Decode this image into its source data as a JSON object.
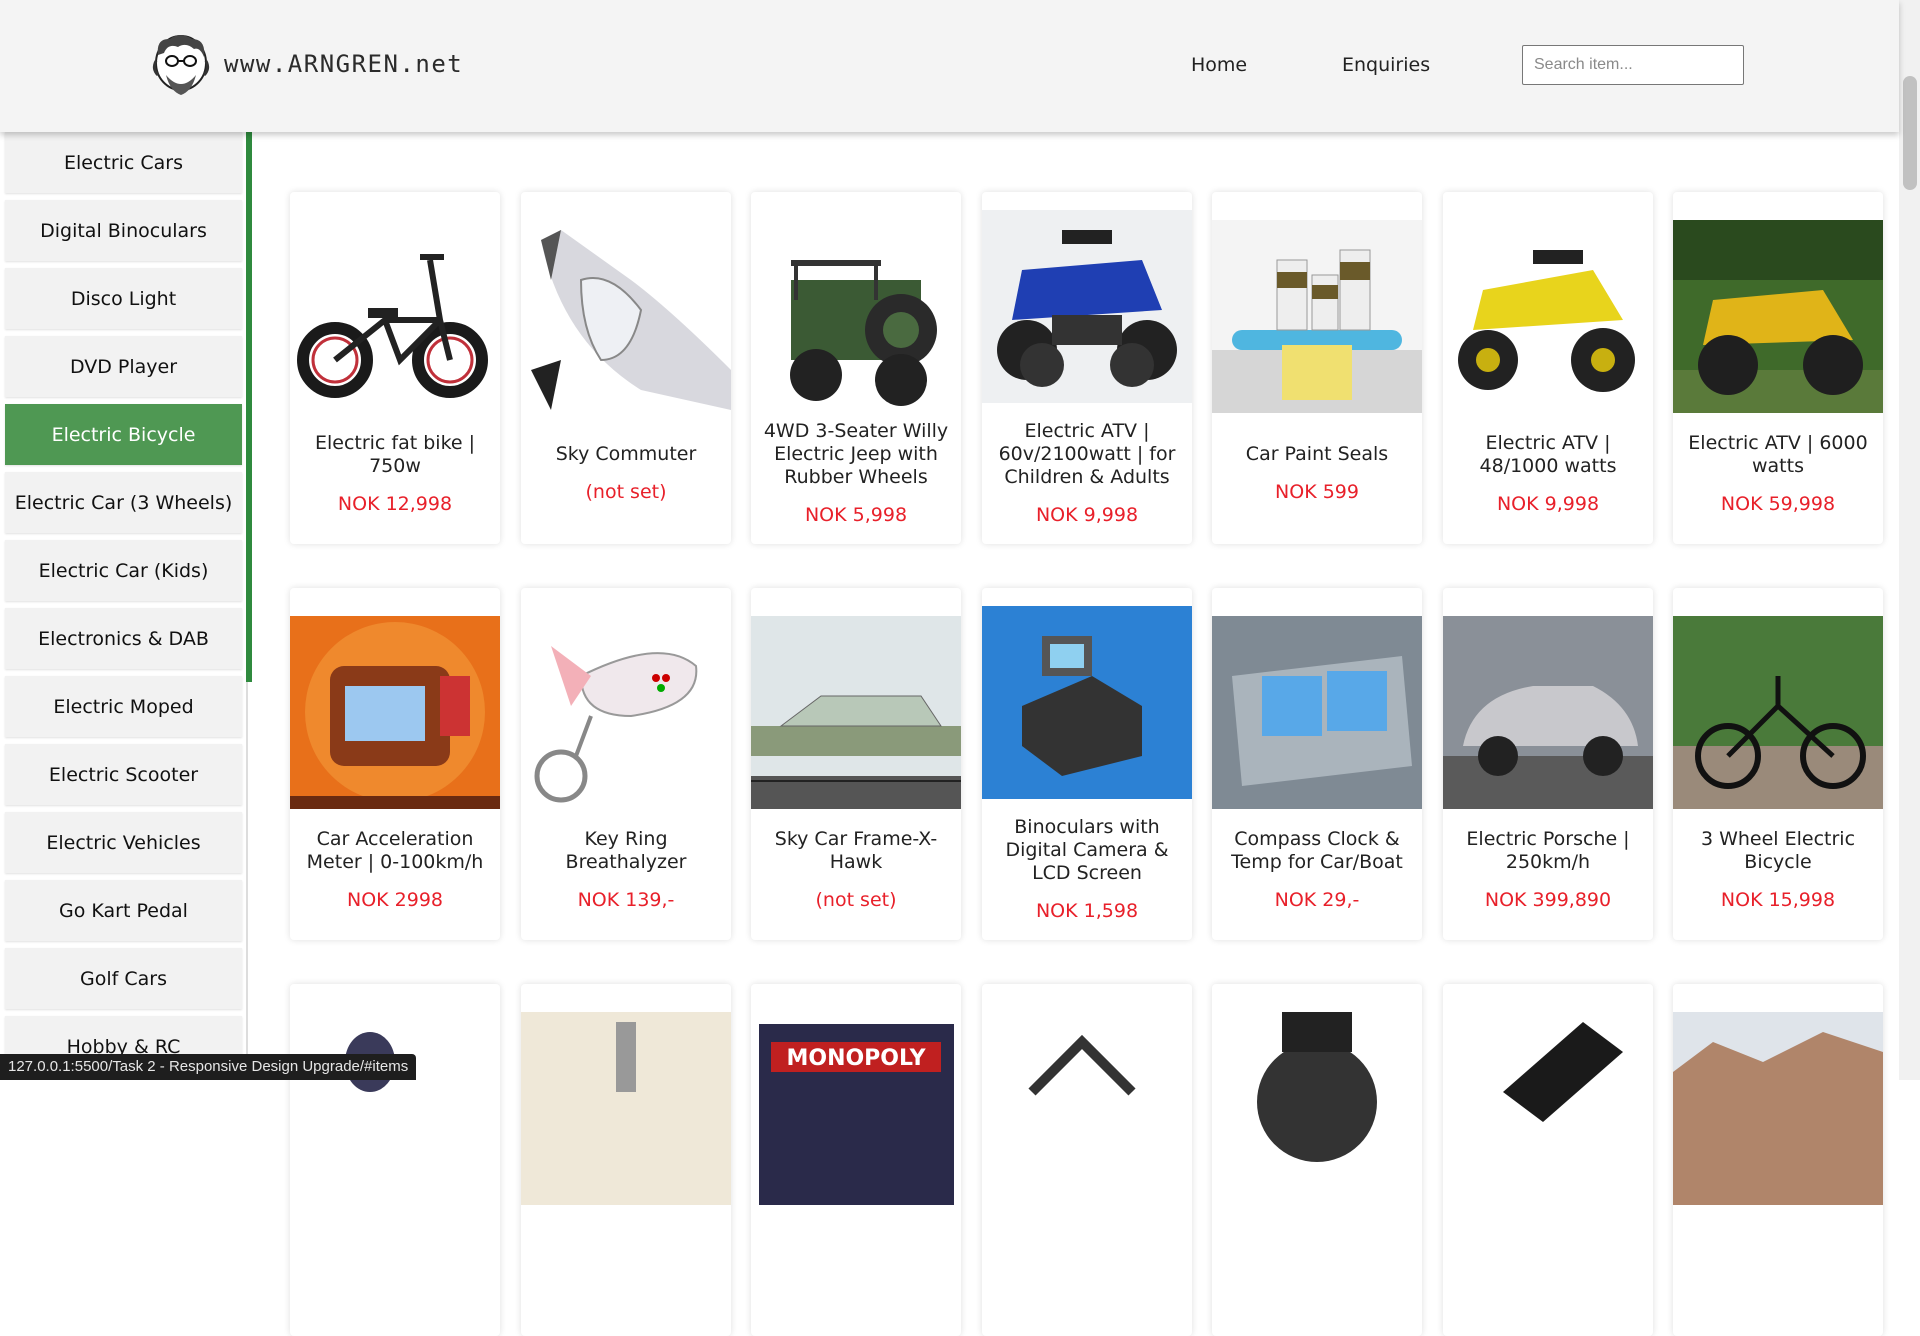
{
  "header": {
    "logo_text": "www.ARNGREN.net",
    "nav": [
      {
        "label": "Home"
      },
      {
        "label": "Enquiries"
      }
    ],
    "search_placeholder": "Search item..."
  },
  "sidebar": {
    "accent": "#2f8a3e",
    "items": [
      {
        "label": "Electric Cars",
        "active": false
      },
      {
        "label": "Digital Binoculars",
        "active": false
      },
      {
        "label": "Disco Light",
        "active": false
      },
      {
        "label": "DVD Player",
        "active": false
      },
      {
        "label": "Electric Bicycle",
        "active": true
      },
      {
        "label": "Electric Car (3 Wheels)",
        "active": false
      },
      {
        "label": "Electric Car (Kids)",
        "active": false
      },
      {
        "label": "Electronics & DAB",
        "active": false
      },
      {
        "label": "Electric Moped",
        "active": false
      },
      {
        "label": "Electric Scooter",
        "active": false
      },
      {
        "label": "Electric Vehicles",
        "active": false
      },
      {
        "label": "Go Kart Pedal",
        "active": false
      },
      {
        "label": "Golf Cars",
        "active": false
      },
      {
        "label": "Hobby & RC",
        "active": false
      }
    ]
  },
  "products": {
    "price_color": "#e8202a",
    "rows": [
      [
        {
          "name": "Electric fat bike | 750w",
          "price": "NOK 12,998",
          "image": "bike"
        },
        {
          "name": "Sky Commuter",
          "price": "(not set)",
          "image": "sky"
        },
        {
          "name": "4WD 3-Seater Willy Electric Jeep with Rubber Wheels",
          "price": "NOK 5,998",
          "image": "jeep"
        },
        {
          "name": "Electric ATV | 60v/2100watt | for Children & Adults",
          "price": "NOK 9,998",
          "image": "atv-blue"
        },
        {
          "name": "Car Paint Seals",
          "price": "NOK 599",
          "image": "paint"
        },
        {
          "name": "Electric ATV | 48/1000 watts",
          "price": "NOK 9,998",
          "image": "atv-yellow"
        },
        {
          "name": "Electric ATV | 6000 watts",
          "price": "NOK 59,998",
          "image": "atv-grass"
        }
      ],
      [
        {
          "name": "Car Acceleration Meter | 0-100km/h",
          "price": "NOK 2998",
          "image": "meter"
        },
        {
          "name": "Key Ring Breathalyzer",
          "price": "NOK 139,-",
          "image": "keyring"
        },
        {
          "name": "Sky Car Frame-X-Hawk",
          "price": "(not set)",
          "image": "hawk"
        },
        {
          "name": "Binoculars with Digital Camera & LCD Screen",
          "price": "NOK 1,598",
          "image": "binoculars"
        },
        {
          "name": "Compass Clock & Temp for Car/Boat",
          "price": "NOK 29,-",
          "image": "compass"
        },
        {
          "name": "Electric Porsche | 250km/h",
          "price": "NOK 399,890",
          "image": "porsche"
        },
        {
          "name": "3 Wheel Electric Bicycle",
          "price": "NOK 15,998",
          "image": "trike"
        }
      ],
      [
        {
          "image": "partial-1"
        },
        {
          "image": "partial-2"
        },
        {
          "image": "partial-3",
          "text": "MONOPOLY"
        },
        {
          "image": "partial-4"
        },
        {
          "image": "partial-5"
        },
        {
          "image": "partial-6"
        },
        {
          "image": "partial-7"
        }
      ]
    ]
  },
  "status_bar": "127.0.0.1:5500/Task 2 - Responsive Design Upgrade/#items"
}
